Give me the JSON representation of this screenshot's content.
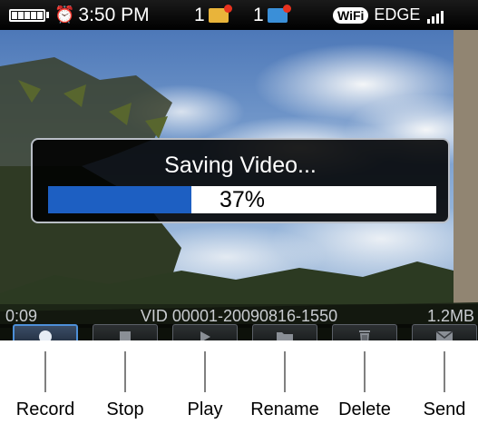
{
  "status_bar": {
    "time": "3:50 PM",
    "messages_count": "1",
    "mail_count": "1",
    "wifi_label": "WiFi",
    "network_label": "EDGE",
    "icons": [
      "battery-icon",
      "alarm-clock-icon",
      "message-icon",
      "mail-icon",
      "wifi-icon",
      "signal-icon"
    ]
  },
  "dialog": {
    "title": "Saving Video...",
    "progress_label": "37%",
    "progress_fraction": 0.37
  },
  "info_bar": {
    "elapsed": "0:09",
    "filename": "VID 00001-20090816-1550",
    "file_size": "1.2MB"
  },
  "toolbar": {
    "buttons": [
      {
        "label": "Record",
        "icon": "record-icon"
      },
      {
        "label": "Stop",
        "icon": "stop-icon"
      },
      {
        "label": "Play",
        "icon": "play-icon"
      },
      {
        "label": "Rename",
        "icon": "folder-icon"
      },
      {
        "label": "Delete",
        "icon": "trash-icon"
      },
      {
        "label": "Send",
        "icon": "envelope-icon"
      }
    ],
    "selected_index": 0
  },
  "colors": {
    "progress_fill": "#1d5fc2",
    "selection_border": "#4d8fd8",
    "status_bar_bg": "#000000"
  }
}
